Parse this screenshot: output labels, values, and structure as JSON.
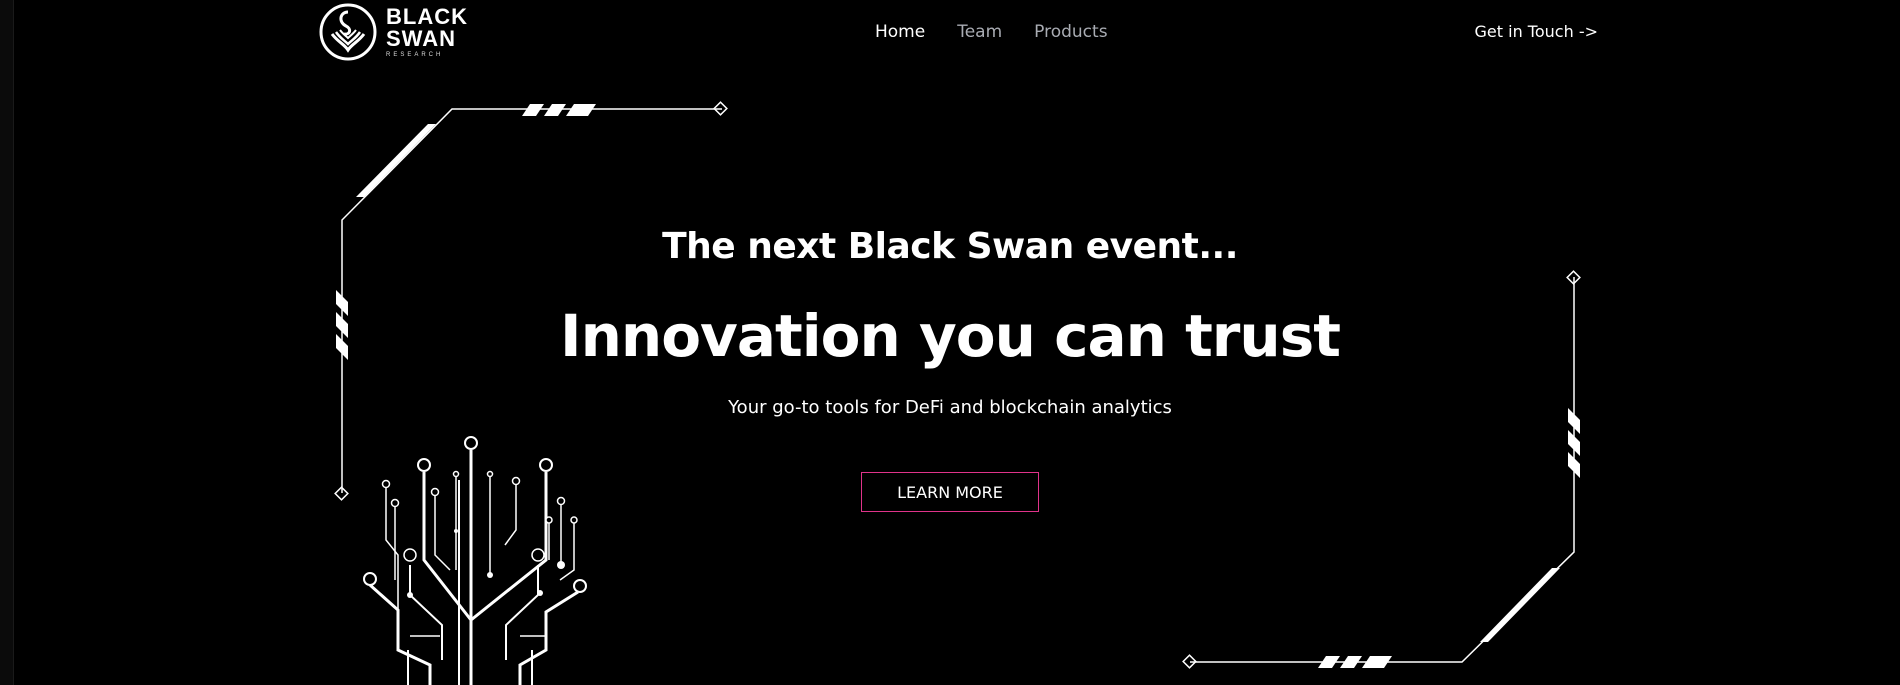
{
  "brand": {
    "line1": "BLACK",
    "line2": "SWAN",
    "line3": "RESEARCH"
  },
  "nav": {
    "items": [
      {
        "label": "Home",
        "active": true
      },
      {
        "label": "Team",
        "active": false
      },
      {
        "label": "Products",
        "active": false
      }
    ]
  },
  "header": {
    "cta": "Get in Touch ->"
  },
  "hero": {
    "tagline": "The next Black Swan event...",
    "headline": "Innovation you can trust",
    "subline": "Your go-to tools for DeFi and blockchain analytics",
    "button": "LEARN MORE"
  },
  "colors": {
    "background": "#000000",
    "text": "#ffffff",
    "muted_nav": "#a9acb3",
    "button_border": "#e0338a"
  }
}
